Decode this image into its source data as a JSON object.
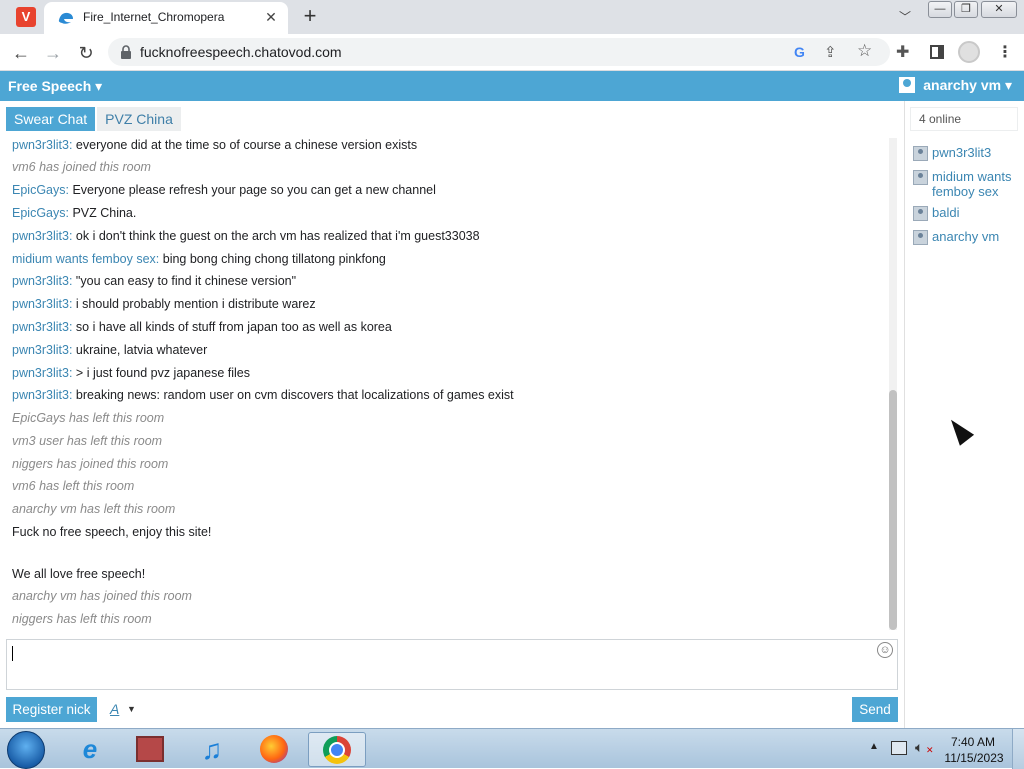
{
  "browser": {
    "tab_title": "Fire_Internet_Chromopera",
    "tab_close": "✕",
    "new_tab": "+",
    "url": "fucknofreespeech.chatovod.com",
    "window_buttons": {
      "min": "—",
      "max": "❐",
      "close": "✕"
    }
  },
  "chat": {
    "room_title": "Free Speech ▾",
    "user_menu": "anarchy vm ▾",
    "channels": [
      "Swear Chat",
      "PVZ China"
    ],
    "messages": [
      {
        "nick": "pwn3r3lit3:",
        "text": " everyone did at the time so of course a chinese version exists",
        "type": "msg"
      },
      {
        "nick": "",
        "text": "vm6 has joined this room",
        "type": "sys"
      },
      {
        "nick": "EpicGays:",
        "text": " Everyone please refresh your page so you can get a new channel",
        "type": "msg"
      },
      {
        "nick": "EpicGays:",
        "text": " PVZ China.",
        "type": "msg"
      },
      {
        "nick": "pwn3r3lit3:",
        "text": " ok i don't think the guest on the arch vm has realized that i'm guest33038",
        "type": "msg"
      },
      {
        "nick": "midium wants femboy sex:",
        "text": " bing bong ching chong tillatong pinkfong",
        "type": "msg"
      },
      {
        "nick": "pwn3r3lit3:",
        "text": " \"you can easy to find it chinese version\"",
        "type": "msg"
      },
      {
        "nick": "pwn3r3lit3:",
        "text": " i should probably mention i distribute warez",
        "type": "msg"
      },
      {
        "nick": "pwn3r3lit3:",
        "text": " so i have all kinds of stuff from japan too as well as korea",
        "type": "msg"
      },
      {
        "nick": "pwn3r3lit3:",
        "text": " ukraine, latvia whatever",
        "type": "msg"
      },
      {
        "nick": "pwn3r3lit3:",
        "text": " > i just found pvz japanese files",
        "type": "msg"
      },
      {
        "nick": "pwn3r3lit3:",
        "text": " breaking news: random user on cvm discovers that localizations of games exist",
        "type": "msg"
      },
      {
        "nick": "",
        "text": "EpicGays has left this room",
        "type": "sys"
      },
      {
        "nick": "",
        "text": "vm3 user has left this room",
        "type": "sys"
      },
      {
        "nick": "",
        "text": "niggers has joined this room",
        "type": "sys"
      },
      {
        "nick": "",
        "text": "vm6 has left this room",
        "type": "sys"
      },
      {
        "nick": "",
        "text": "anarchy vm has left this room",
        "type": "sys"
      },
      {
        "nick": "",
        "text": "Fuck no free speech, enjoy this site!",
        "type": "plain"
      },
      {
        "nick": "",
        "text": "We all love free speech!",
        "type": "plain"
      },
      {
        "nick": "",
        "text": "anarchy vm has joined this room",
        "type": "sys"
      },
      {
        "nick": "",
        "text": "niggers has left this room",
        "type": "sys"
      }
    ],
    "input_value": "",
    "register_label": "Register nick",
    "font_label": "A",
    "send_label": "Send"
  },
  "sidebar": {
    "online": "4 online",
    "users": [
      "pwn3r3lit3",
      "midium wants femboy sex",
      "baldi",
      "anarchy vm"
    ]
  },
  "taskbar": {
    "time": "7:40 AM",
    "date": "11/15/2023",
    "apps": [
      "Internet Explorer",
      "Archive",
      "Music",
      "Firefox",
      "Chrome"
    ]
  },
  "colors": {
    "accent": "#4da6d4",
    "nick": "#3b86b2",
    "system": "#8a8a8a"
  },
  "icons": [
    "vivaldi-icon",
    "edge-favicon-icon",
    "lock-icon",
    "google-icon",
    "share-icon",
    "star-icon",
    "extensions-icon",
    "side-panel-icon",
    "profile-icon",
    "menu-icon",
    "user-icon",
    "smiley-icon",
    "start-orb-icon"
  ]
}
